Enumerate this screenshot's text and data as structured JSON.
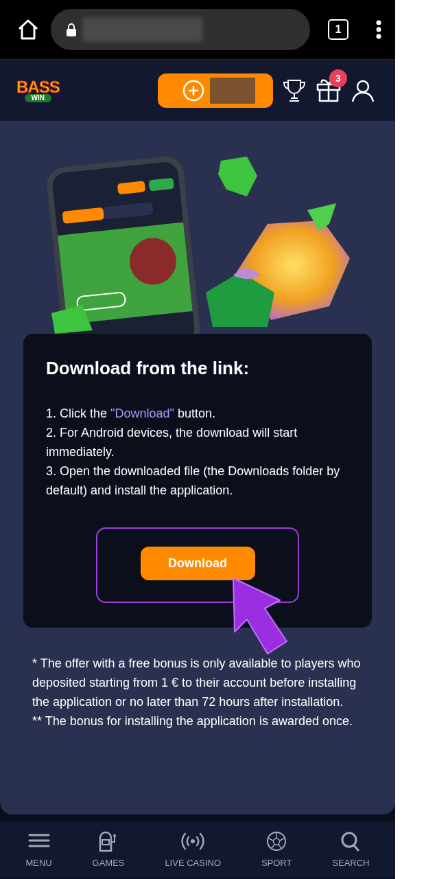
{
  "browser": {
    "tab_count": "1"
  },
  "header": {
    "logo": {
      "line1": "BASS",
      "line2": "WIN"
    },
    "gift_badge": "3"
  },
  "download_card": {
    "title": "Download from the link:",
    "step_1": {
      "before": "1. Click the ",
      "link": "\"Download\"",
      "after": " button."
    },
    "steps": [
      "2. For Android devices, the download will start immediately.",
      "3. Open the downloaded file (the Downloads folder by default) and install the application."
    ],
    "button": "Download"
  },
  "footnotes": [
    "* The offer with a free bonus is only available to players who deposited starting from 1 € to their account before installing the application or no later than 72 hours after installation.",
    "** The bonus for installing the application is awarded once."
  ],
  "bottom_nav": [
    {
      "kind": "menu",
      "label": "MENU"
    },
    {
      "kind": "games",
      "label": "GAMES"
    },
    {
      "kind": "live",
      "label": "LIVE CASINO"
    },
    {
      "kind": "sport",
      "label": "SPORT"
    },
    {
      "kind": "search",
      "label": "SEARCH"
    }
  ]
}
